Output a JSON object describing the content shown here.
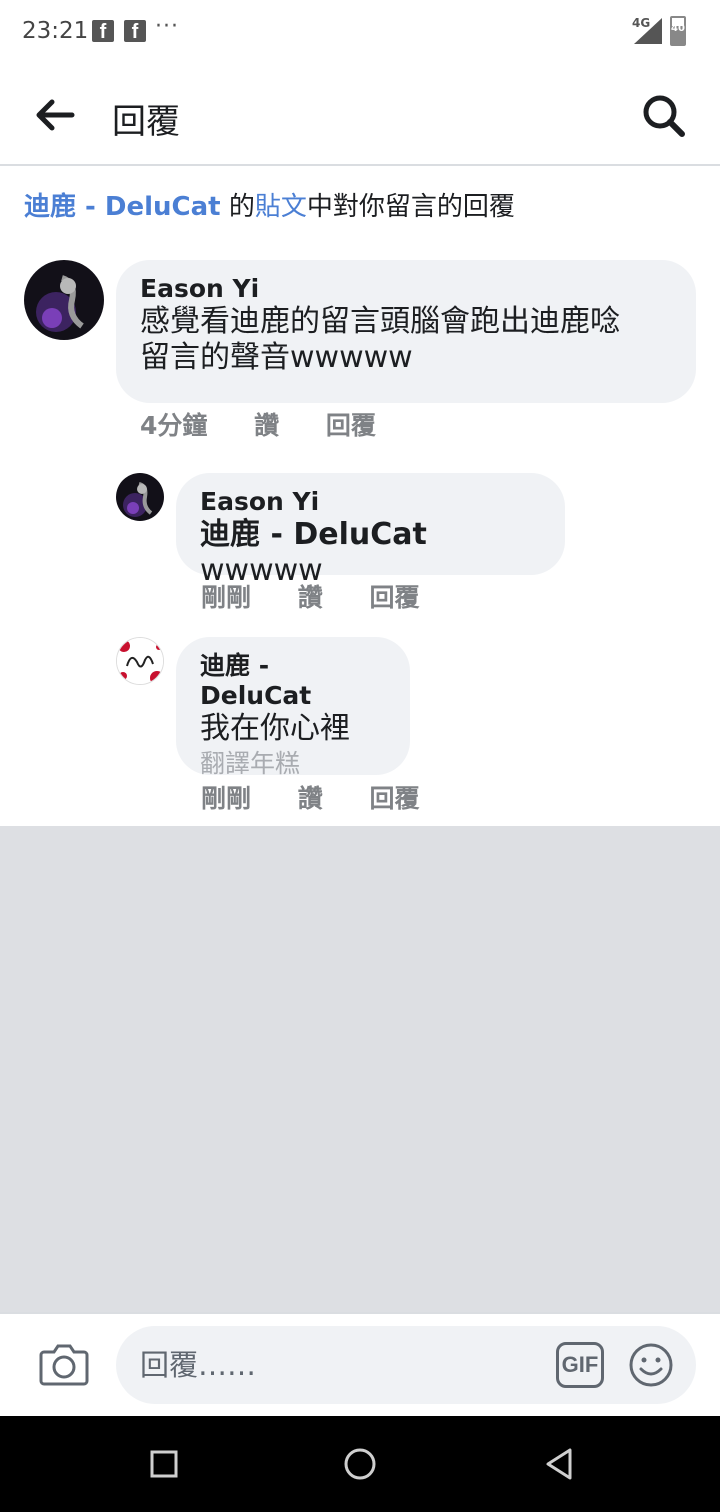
{
  "status_bar": {
    "time": "23:21",
    "notification_icons": [
      "facebook-icon",
      "facebook-icon"
    ],
    "more": "···",
    "network": "4G",
    "battery": "40"
  },
  "header": {
    "title": "回覆",
    "back_icon": "back-arrow-icon",
    "search_icon": "search-icon"
  },
  "context": {
    "author": "迪鹿 - DeluCat",
    "possessive": "的",
    "post_link": "貼文",
    "rest": "中對你留言的回覆"
  },
  "comments": [
    {
      "author": "Eason Yi",
      "text_line1": "感覺看迪鹿的留言頭腦會跑出迪鹿唸",
      "text_line2": "留言的聲音wwwww",
      "time": "4分鐘",
      "like": "讚",
      "reply": "回覆"
    },
    {
      "author": "Eason Yi",
      "tagged_name": "迪鹿 - DeluCat",
      "text_suffix": " wwwww",
      "time": "剛剛",
      "like": "讚",
      "reply": "回覆"
    },
    {
      "author": "迪鹿 - DeluCat",
      "text": "我在你心裡",
      "translate": "翻譯年糕",
      "time": "剛剛",
      "like": "讚",
      "reply": "回覆"
    }
  ],
  "composer": {
    "placeholder": "回覆……",
    "gif_label": "GIF",
    "camera_icon": "camera-icon",
    "emoji_icon": "emoji-icon"
  },
  "nav": {
    "icons": [
      "recent-apps-icon",
      "home-icon",
      "back-icon"
    ]
  },
  "colors": {
    "link_blue": "#4b7fd4",
    "bubble_bg": "#f0f2f5",
    "empty_bg": "#dddfe3",
    "meta_grey": "#7f8286"
  }
}
